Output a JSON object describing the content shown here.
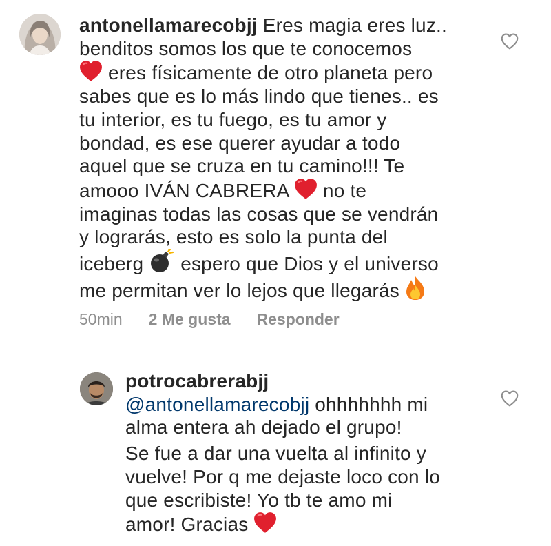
{
  "comments": [
    {
      "username": "antonellamarecobjj",
      "lines": [
        "Eres magia eres luz..",
        "benditos somos los que te conocemos",
        "eres físicamente de otro planeta pero",
        "sabes que es lo más lindo que tienes.. es",
        "tu interior, es tu fuego, es tu amor y",
        "bondad, es ese querer ayudar a todo",
        "aquel que se cruza en tu camino!!! Te",
        "amooo IVÁN CABRERA",
        "no te",
        "imaginas todas las cosas que se vendrán",
        "y lograrás, esto es solo la punta del",
        "iceberg",
        "espero que Dios y el universo",
        "me permitan ver lo lejos que llegarás"
      ],
      "time": "50min",
      "likes": "2 Me gusta",
      "reply_label": "Responder"
    },
    {
      "username": "potrocabrerabjj",
      "mention": "@antonellamarecobjj",
      "lines": [
        "ohhhhhhh mi",
        "alma entera ah dejado el grupo!",
        "Se fue a dar una vuelta al infinito y",
        "vuelve! Por q me dejaste loco con lo",
        "que escribiste! Yo tb te amo mi",
        "amor! Gracias"
      ]
    }
  ],
  "icons": {
    "like": "heart-outline-icon",
    "heart": "red-heart-emoji",
    "bomb": "bomb-emoji",
    "fire": "fire-emoji"
  },
  "colors": {
    "text": "#262626",
    "meta": "#8e8e8e",
    "mention": "#00376b",
    "heart": "#e0202e"
  }
}
